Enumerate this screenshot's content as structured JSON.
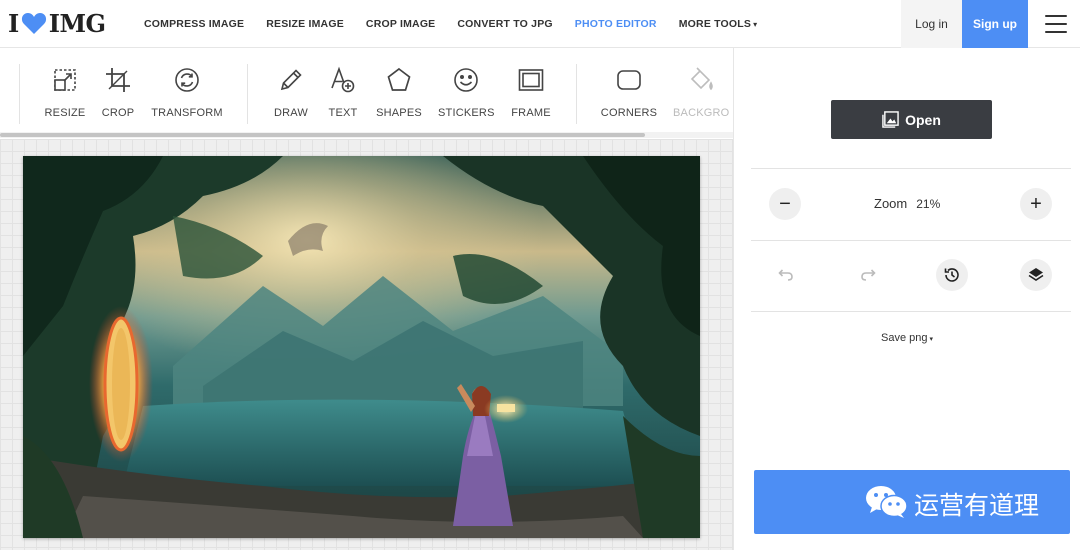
{
  "logo": {
    "prefix": "I",
    "suffix": "IMG",
    "heart_color": "#4d8ef4"
  },
  "nav": {
    "items": [
      {
        "label": "COMPRESS IMAGE"
      },
      {
        "label": "RESIZE IMAGE"
      },
      {
        "label": "CROP IMAGE"
      },
      {
        "label": "CONVERT TO JPG"
      },
      {
        "label": "PHOTO EDITOR",
        "active": true
      },
      {
        "label": "MORE TOOLS",
        "caret": "▾"
      }
    ]
  },
  "auth": {
    "login": "Log in",
    "signup": "Sign up"
  },
  "toolbar": {
    "tools": [
      {
        "label": "RESIZE",
        "icon": "resize-icon"
      },
      {
        "label": "CROP",
        "icon": "crop-icon"
      },
      {
        "label": "TRANSFORM",
        "icon": "transform-icon"
      },
      {
        "label": "DRAW",
        "icon": "pencil-icon"
      },
      {
        "label": "TEXT",
        "icon": "text-add-icon"
      },
      {
        "label": "SHAPES",
        "icon": "shapes-icon"
      },
      {
        "label": "STICKERS",
        "icon": "smiley-icon"
      },
      {
        "label": "FRAME",
        "icon": "frame-icon"
      },
      {
        "label": "CORNERS",
        "icon": "corners-icon"
      },
      {
        "label": "BACKGRO",
        "icon": "paint-bucket-icon"
      }
    ]
  },
  "panel": {
    "open_label": "Open",
    "zoom_label": "Zoom",
    "zoom_value": "21%",
    "zoom_out": "−",
    "zoom_in": "+",
    "save_format": "Save png",
    "save_caret": "▾",
    "watermark_text": "运营有道理"
  },
  "colors": {
    "accent": "#4d8ef4",
    "dark_button": "#3a3d42"
  }
}
